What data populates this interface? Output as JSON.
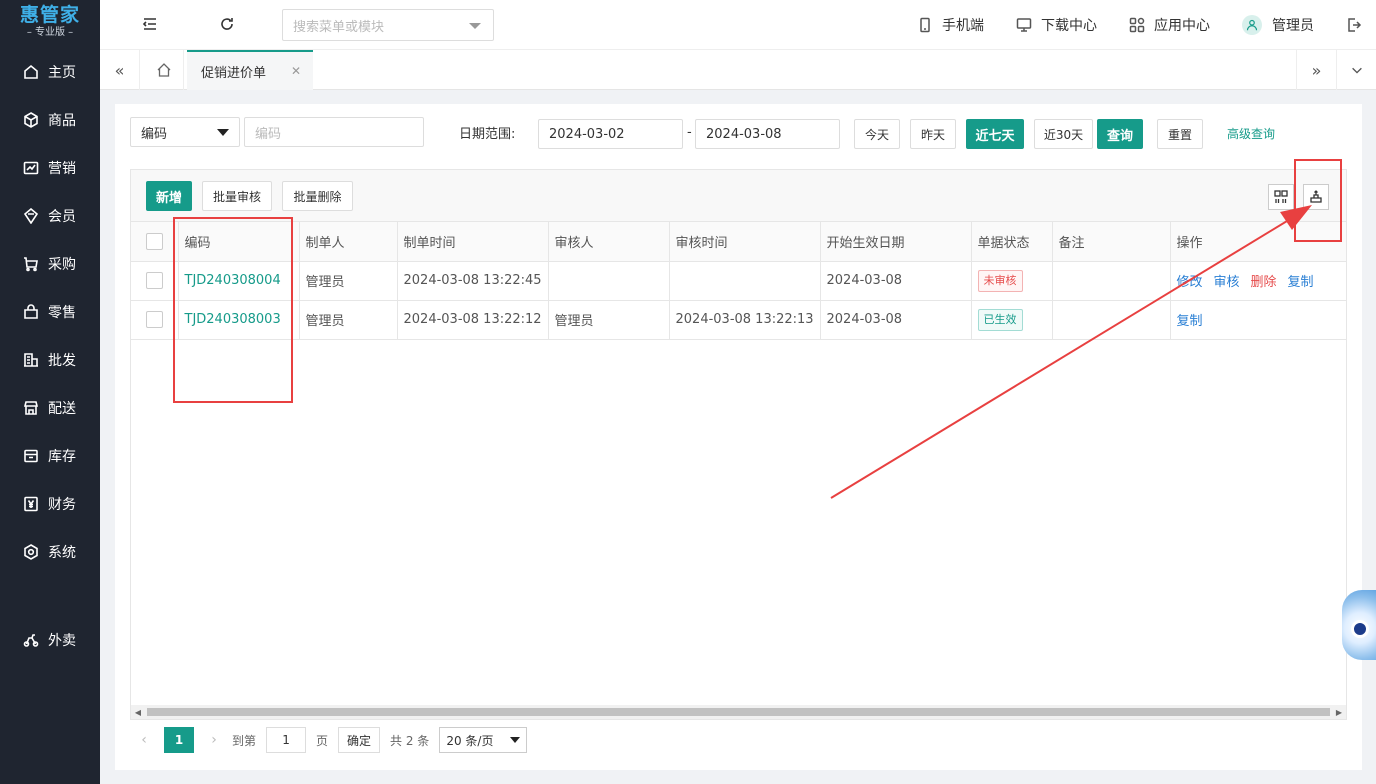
{
  "app": {
    "brand": "惠管家",
    "edition": "专业版"
  },
  "sidebar": {
    "items": [
      {
        "label": "主页",
        "icon": "home-icon"
      },
      {
        "label": "商品",
        "icon": "box-icon"
      },
      {
        "label": "营销",
        "icon": "trend-icon"
      },
      {
        "label": "会员",
        "icon": "member-icon"
      },
      {
        "label": "采购",
        "icon": "cart-icon"
      },
      {
        "label": "零售",
        "icon": "bag-icon"
      },
      {
        "label": "批发",
        "icon": "building-icon"
      },
      {
        "label": "配送",
        "icon": "store-icon"
      },
      {
        "label": "库存",
        "icon": "inventory-icon"
      },
      {
        "label": "财务",
        "icon": "yen-icon"
      },
      {
        "label": "系统",
        "icon": "gear-icon"
      },
      {
        "label": "外卖",
        "icon": "scooter-icon"
      }
    ]
  },
  "header": {
    "search_placeholder": "搜索菜单或模块",
    "mobile": "手机端",
    "download": "下载中心",
    "apps": "应用中心",
    "user": "管理员"
  },
  "tabs": {
    "active": "促销进价单"
  },
  "filter": {
    "field_select": "编码",
    "field_placeholder": "编码",
    "date_label": "日期范围:",
    "date_from": "2024-03-02",
    "date_sep": "-",
    "date_to": "2024-03-08",
    "today": "今天",
    "yesterday": "昨天",
    "last7": "近七天",
    "last30": "近30天",
    "query": "查询",
    "reset": "重置",
    "advanced": "高级查询"
  },
  "toolbar": {
    "add": "新增",
    "batch_audit": "批量审核",
    "batch_delete": "批量删除"
  },
  "table": {
    "columns": [
      "编码",
      "制单人",
      "制单时间",
      "审核人",
      "审核时间",
      "开始生效日期",
      "单据状态",
      "备注",
      "操作"
    ],
    "rows": [
      {
        "code": "TJD240308004",
        "creator": "管理员",
        "created_at": "2024-03-08 13:22:45",
        "auditor": "",
        "audited_at": "",
        "effective_date": "2024-03-08",
        "status": "未审核",
        "remark": "",
        "ops": [
          "修改",
          "审核",
          "删除",
          "复制"
        ]
      },
      {
        "code": "TJD240308003",
        "creator": "管理员",
        "created_at": "2024-03-08 13:22:12",
        "auditor": "管理员",
        "audited_at": "2024-03-08 13:22:13",
        "effective_date": "2024-03-08",
        "status": "已生效",
        "remark": "",
        "ops": [
          "复制"
        ]
      }
    ]
  },
  "pager": {
    "current": "1",
    "goto_label": "到第",
    "goto_value": "1",
    "page_unit": "页",
    "confirm": "确定",
    "total": "共 2 条",
    "page_size": "20 条/页"
  },
  "colors": {
    "accent": "#169b8a",
    "sidebar_bg": "#1f2530",
    "annotation": "#e84040"
  }
}
